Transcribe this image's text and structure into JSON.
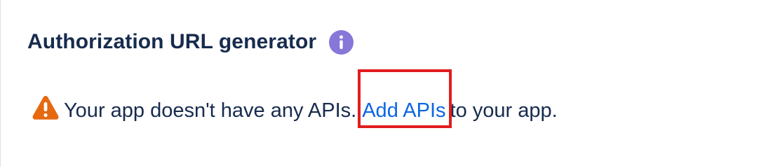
{
  "panel": {
    "title": "Authorization URL generator",
    "info_icon": "info-icon",
    "warning_icon": "warning-icon"
  },
  "message": {
    "prefix": "Your app doesn't have any APIs.",
    "link_label": "Add APIs",
    "suffix": "to your app."
  },
  "colors": {
    "title": "#172b4d",
    "info_icon": "#8777d9",
    "warning_icon": "#e56910",
    "link": "#0c66e4",
    "highlight_border": "#e11d1d"
  }
}
